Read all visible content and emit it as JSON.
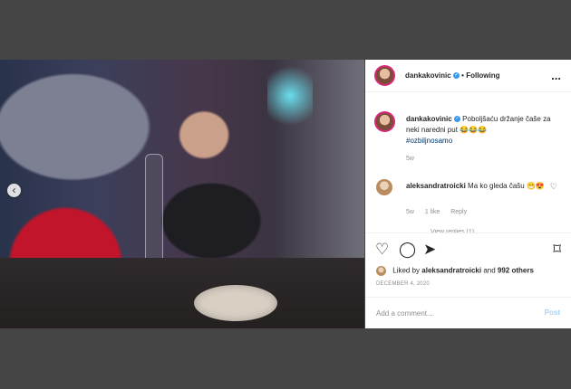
{
  "post": {
    "username": "dankakovinic",
    "separator": "•",
    "following": "Following",
    "more": "..."
  },
  "caption": {
    "text": "Poboljšaću držanje čaše za neki naredni put 😂😂😂",
    "hashtag": "#ozbiljnosamo",
    "time": "5w"
  },
  "comment": {
    "username": "aleksandratroicki",
    "text": "Ma ko gleda čašu 😁😍",
    "time": "5w",
    "likes": "1 like",
    "reply": "Reply",
    "view_replies": "View replies (1)"
  },
  "actions": {
    "like_icon": "heart-icon",
    "comment_icon": "comment-icon",
    "share_icon": "share-icon",
    "save_icon": "bookmark-icon",
    "liked_by_prefix": "Liked by",
    "liked_by_user": "aleksandratroicki",
    "liked_by_and": "and",
    "liked_by_count": "992 others",
    "date": "DECEMBER 4, 2020"
  },
  "input": {
    "placeholder": "Add a comment...",
    "post": "Post"
  },
  "colors": {
    "background": "#454545",
    "link": "#00376b",
    "muted": "#8e8e8e",
    "post": "#a7d3f8",
    "verified": "#3897f0"
  }
}
